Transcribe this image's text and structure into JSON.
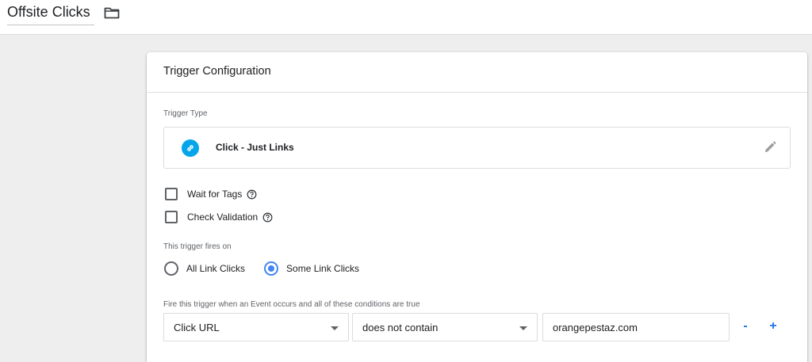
{
  "header": {
    "trigger_name": "Offsite Clicks",
    "folder_icon": "folder-icon"
  },
  "card": {
    "title": "Trigger Configuration",
    "trigger_type_label": "Trigger Type",
    "trigger_type": {
      "name": "Click - Just Links",
      "icon": "link-icon",
      "icon_color": "#04a5ea",
      "edit_icon": "pencil-icon"
    },
    "options": [
      {
        "label": "Wait for Tags",
        "checked": false
      },
      {
        "label": "Check Validation",
        "checked": false
      }
    ],
    "fires_on_label": "This trigger fires on",
    "fires_on": {
      "all_label": "All Link Clicks",
      "some_label": "Some Link Clicks",
      "selected": "Some Link Clicks"
    },
    "condition_label": "Fire this trigger when an Event occurs and all of these conditions are true",
    "condition": {
      "variable": "Click URL",
      "operator": "does not contain",
      "value": "orangepestaz.com",
      "remove_label": "-",
      "add_label": "+"
    },
    "accent_color": "#4285f4"
  }
}
